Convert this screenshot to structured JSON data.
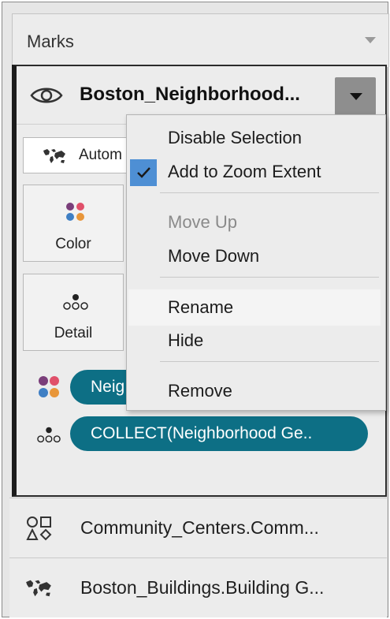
{
  "marks_header": {
    "title": "Marks"
  },
  "layer": {
    "name": "Boston_Neighborhood...",
    "mark_type_label": "Autom",
    "cards": {
      "color": "Color",
      "detail": "Detail"
    },
    "pills": [
      {
        "icon": "color-icon",
        "label": "Neig"
      },
      {
        "icon": "detail-icon",
        "label": "COLLECT(Neighborhood Ge.."
      }
    ]
  },
  "context_menu": {
    "items": [
      {
        "label": "Disable Selection",
        "checked": false,
        "enabled": true
      },
      {
        "label": "Add to Zoom Extent",
        "checked": true,
        "enabled": true
      },
      {
        "label": "Move Up",
        "checked": false,
        "enabled": false
      },
      {
        "label": "Move Down",
        "checked": false,
        "enabled": true
      },
      {
        "label": "Rename",
        "checked": false,
        "enabled": true,
        "highlighted": true
      },
      {
        "label": "Hide",
        "checked": false,
        "enabled": true
      },
      {
        "label": "Remove",
        "checked": false,
        "enabled": true
      }
    ]
  },
  "other_layers": [
    {
      "icon": "shapes-icon",
      "label": "Community_Centers.Comm..."
    },
    {
      "icon": "map-icon",
      "label": "Boston_Buildings.Building G..."
    }
  ],
  "colors": {
    "pill": "#0d6f85",
    "check": "#4e8fd4",
    "dots": [
      "#7a3e7a",
      "#e0506a",
      "#3f7fc4",
      "#e8963a"
    ]
  }
}
